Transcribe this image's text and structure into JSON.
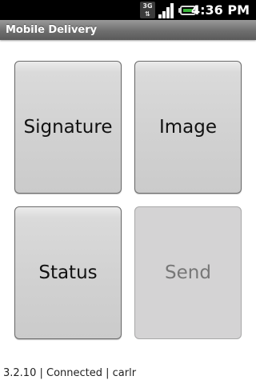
{
  "status_bar": {
    "network_label": "3G",
    "network_arrows": "⇅",
    "time": "4:36 PM",
    "icons": [
      "3g-data-icon",
      "signal-strength-icon",
      "battery-charging-icon"
    ]
  },
  "app": {
    "title": "Mobile Delivery"
  },
  "buttons": {
    "signature": "Signature",
    "image": "Image",
    "status": "Status",
    "send": "Send"
  },
  "footer": {
    "text": "3.2.10 | Connected | carlr"
  },
  "colors": {
    "status_bar_bg": "#000000",
    "title_bar_bg": "#6e6e6e",
    "tile_bg": "#d2d2d2",
    "battery_fill": "#3bb53b",
    "disabled_text": "#777777"
  }
}
